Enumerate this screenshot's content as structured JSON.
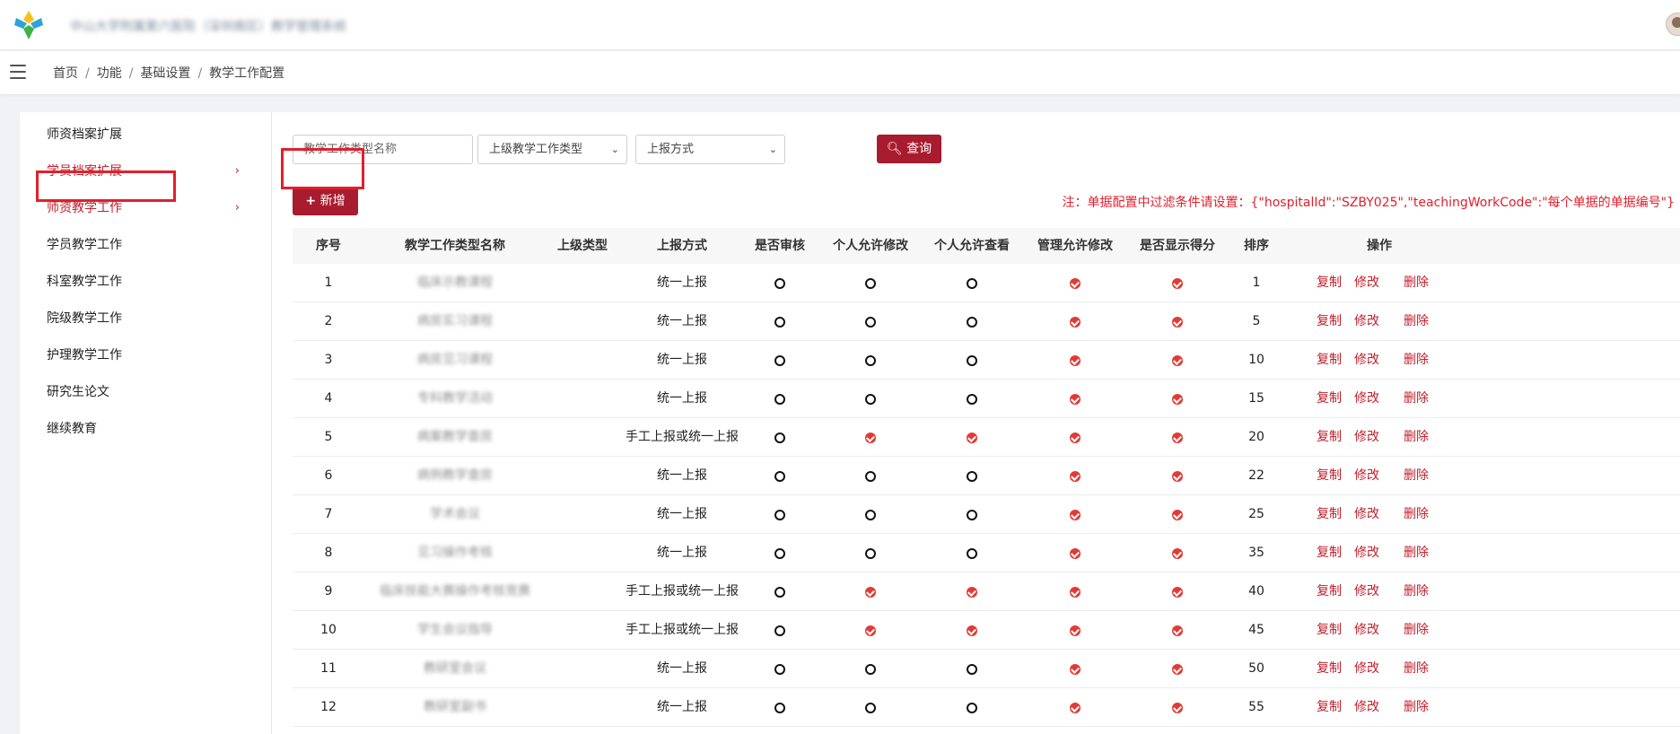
{
  "header": {
    "app_title": "中山大学附属第六医院（深圳南区）教学管理系统"
  },
  "breadcrumb": {
    "items": [
      "首页",
      "功能",
      "基础设置",
      "教学工作配置"
    ]
  },
  "sidebar": {
    "items": [
      {
        "label": "师资档案扩展"
      },
      {
        "label": "学员档案扩展"
      },
      {
        "label": "师资教学工作"
      },
      {
        "label": "学员教学工作"
      },
      {
        "label": "科室教学工作"
      },
      {
        "label": "院级教学工作"
      },
      {
        "label": "护理教学工作"
      },
      {
        "label": "研究生论文"
      },
      {
        "label": "继续教育"
      }
    ]
  },
  "filters": {
    "name_placeholder": "教学工作类型名称",
    "parent_type_select": "上级教学工作类型",
    "report_method_select": "上报方式",
    "query_label": "查询",
    "add_label": "新增"
  },
  "note": "注：单据配置中过滤条件请设置：{\"hospitalId\":\"SZBY025\",\"teachingWorkCode\":\"每个单据的单据编号\"}",
  "table": {
    "headers": [
      "序号",
      "教学工作类型名称",
      "上级类型",
      "上报方式",
      "是否审核",
      "个人允许修改",
      "个人允许查看",
      "管理允许修改",
      "是否显示得分",
      "排序",
      "操作"
    ],
    "actions": [
      "复制",
      "修改",
      "删除"
    ],
    "rows": [
      {
        "no": "1",
        "name": "临床示教课程",
        "parent": "",
        "method": "统一上报",
        "audit": false,
        "self_edit": false,
        "self_view": false,
        "admin_edit": true,
        "show_score": true,
        "sort": "1"
      },
      {
        "no": "2",
        "name": "病房实习课程",
        "parent": "",
        "method": "统一上报",
        "audit": false,
        "self_edit": false,
        "self_view": false,
        "admin_edit": true,
        "show_score": true,
        "sort": "5"
      },
      {
        "no": "3",
        "name": "病房见习课程",
        "parent": "",
        "method": "统一上报",
        "audit": false,
        "self_edit": false,
        "self_view": false,
        "admin_edit": true,
        "show_score": true,
        "sort": "10"
      },
      {
        "no": "4",
        "name": "专科教学活动",
        "parent": "",
        "method": "统一上报",
        "audit": false,
        "self_edit": false,
        "self_view": false,
        "admin_edit": true,
        "show_score": true,
        "sort": "15"
      },
      {
        "no": "5",
        "name": "病案教学查房",
        "parent": "",
        "method": "手工上报或统一上报",
        "audit": false,
        "self_edit": true,
        "self_view": true,
        "admin_edit": true,
        "show_score": true,
        "sort": "20"
      },
      {
        "no": "6",
        "name": "病例教学查房",
        "parent": "",
        "method": "统一上报",
        "audit": false,
        "self_edit": false,
        "self_view": false,
        "admin_edit": true,
        "show_score": true,
        "sort": "22"
      },
      {
        "no": "7",
        "name": "学术会议",
        "parent": "",
        "method": "统一上报",
        "audit": false,
        "self_edit": false,
        "self_view": false,
        "admin_edit": true,
        "show_score": true,
        "sort": "25"
      },
      {
        "no": "8",
        "name": "见习操作考核",
        "parent": "",
        "method": "统一上报",
        "audit": false,
        "self_edit": false,
        "self_view": false,
        "admin_edit": true,
        "show_score": true,
        "sort": "35"
      },
      {
        "no": "9",
        "name": "临床技能大赛操作考核竞赛",
        "parent": "",
        "method": "手工上报或统一上报",
        "audit": false,
        "self_edit": true,
        "self_view": true,
        "admin_edit": true,
        "show_score": true,
        "sort": "40"
      },
      {
        "no": "10",
        "name": "学生会议指导",
        "parent": "",
        "method": "手工上报或统一上报",
        "audit": false,
        "self_edit": true,
        "self_view": true,
        "admin_edit": true,
        "show_score": true,
        "sort": "45"
      },
      {
        "no": "11",
        "name": "教研室会议",
        "parent": "",
        "method": "统一上报",
        "audit": false,
        "self_edit": false,
        "self_view": false,
        "admin_edit": true,
        "show_score": true,
        "sort": "50"
      },
      {
        "no": "12",
        "name": "教研室副书",
        "parent": "",
        "method": "统一上报",
        "audit": false,
        "self_edit": false,
        "self_view": false,
        "admin_edit": true,
        "show_score": true,
        "sort": "55"
      }
    ]
  },
  "colors": {
    "accent": "#a91b2e",
    "link_red": "#c0202c",
    "check_red": "#e23b35"
  }
}
